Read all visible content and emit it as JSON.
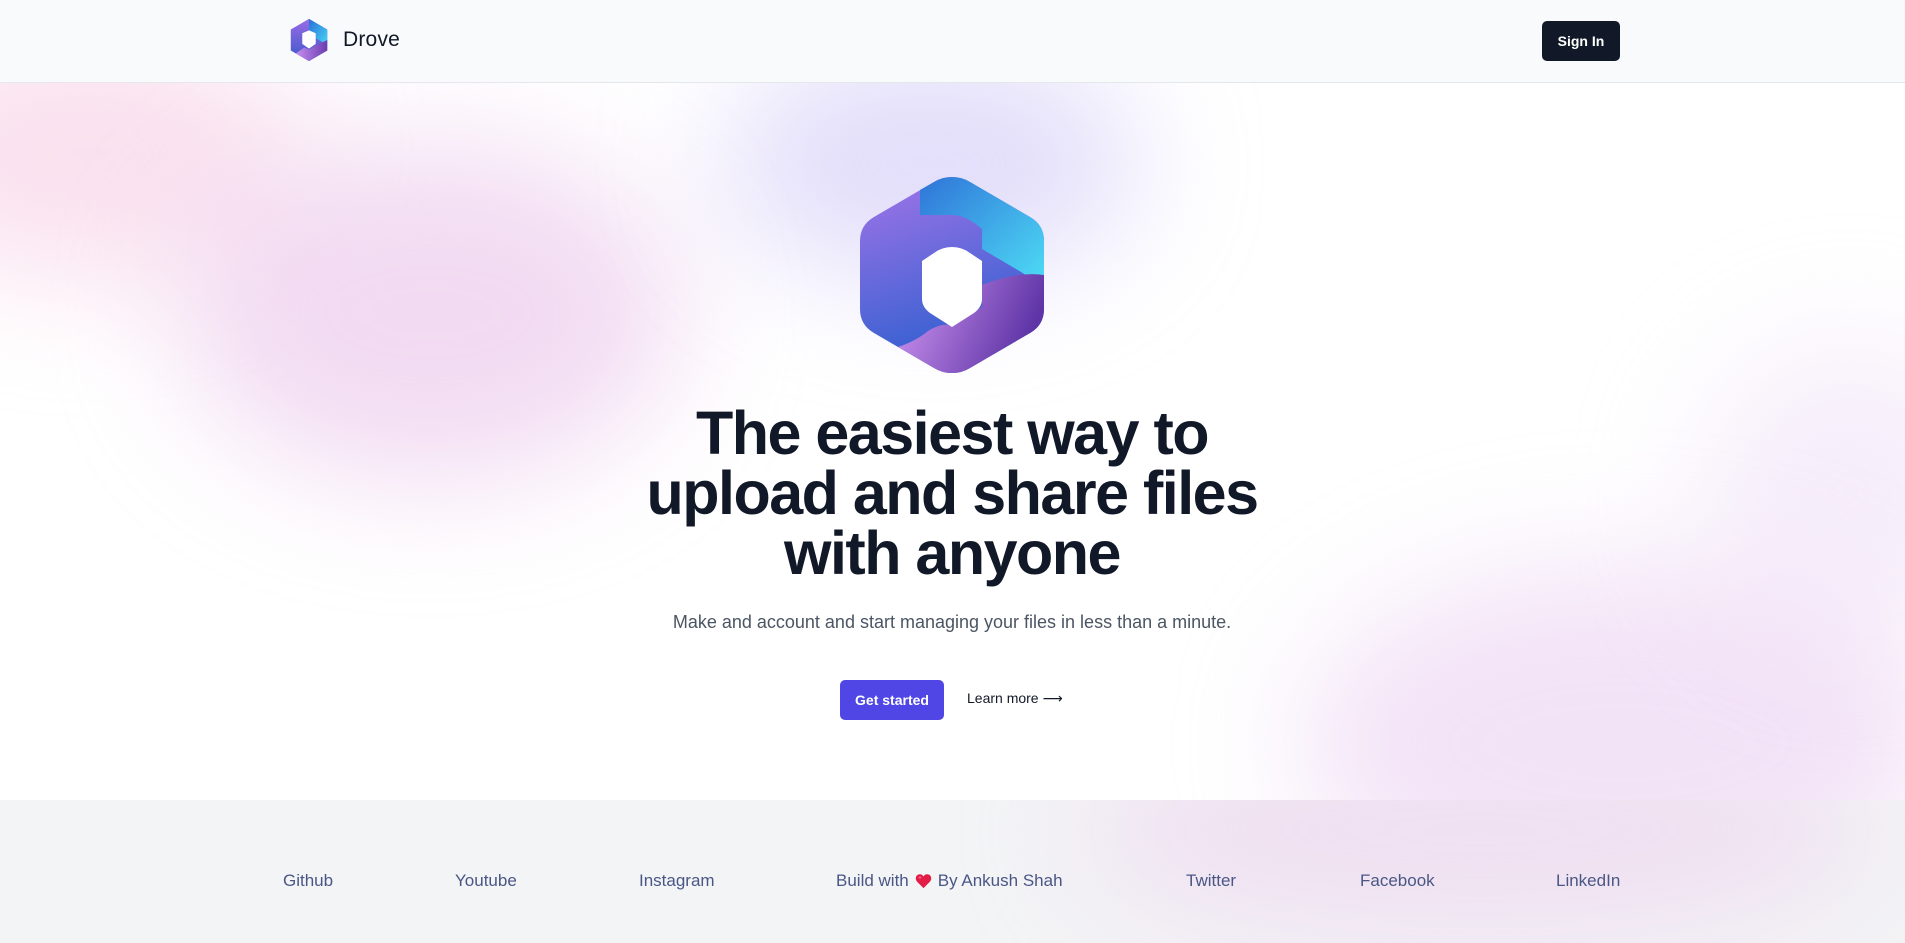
{
  "header": {
    "brand_name": "Drove",
    "signin_label": "Sign In"
  },
  "hero": {
    "title_lines": [
      "The easiest way to",
      "upload and share files",
      "with anyone"
    ],
    "subtitle": "Make and account and start managing your files in less than a minute.",
    "get_started_label": "Get started",
    "learn_more_label": "Learn more",
    "learn_more_arrow": "⟶"
  },
  "footer": {
    "links": [
      "Github",
      "Youtube",
      "Instagram",
      "Twitter",
      "Facebook",
      "LinkedIn"
    ],
    "credit_prefix": "Build with",
    "credit_suffix": "By Ankush Shah"
  },
  "colors": {
    "primary_dark": "#111827",
    "accent": "#4f46e5",
    "footer_link": "#4a5685",
    "heart": "#e11d48"
  },
  "icons": {
    "brand_logo": "hexagon-ring-logo",
    "heart": "heart-icon",
    "arrow": "arrow-right-icon"
  }
}
